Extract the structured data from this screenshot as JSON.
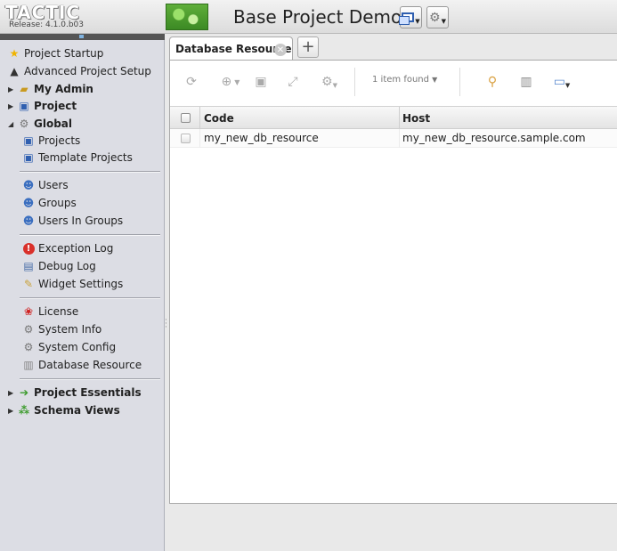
{
  "header": {
    "logo": "TACTIC",
    "release": "Release: 4.1.0.b03",
    "project_title": "Base Project Demo"
  },
  "sidebar": {
    "items": [
      {
        "label": "Project Startup",
        "icon": "star-icon"
      },
      {
        "label": "Advanced Project Setup",
        "icon": "graduation-cap-icon"
      },
      {
        "label": "My Admin",
        "icon": "folder-icon",
        "expanded": false
      },
      {
        "label": "Project",
        "icon": "window-icon",
        "expanded": false
      },
      {
        "label": "Global",
        "icon": "gear-icon",
        "expanded": true
      },
      {
        "label": "Projects",
        "icon": "window-icon"
      },
      {
        "label": "Template Projects",
        "icon": "window-icon"
      },
      {
        "label": "Users",
        "icon": "user-icon"
      },
      {
        "label": "Groups",
        "icon": "group-icon"
      },
      {
        "label": "Users In Groups",
        "icon": "users-in-groups-icon"
      },
      {
        "label": "Exception Log",
        "icon": "alert-icon"
      },
      {
        "label": "Debug Log",
        "icon": "log-icon"
      },
      {
        "label": "Widget Settings",
        "icon": "wrench-icon"
      },
      {
        "label": "License",
        "icon": "ribbon-icon"
      },
      {
        "label": "System Info",
        "icon": "gear-page-icon"
      },
      {
        "label": "System Config",
        "icon": "gear-page-icon"
      },
      {
        "label": "Database Resource",
        "icon": "database-icon"
      },
      {
        "label": "Project Essentials",
        "icon": "arrow-page-icon",
        "expanded": false
      },
      {
        "label": "Schema Views",
        "icon": "schema-icon",
        "expanded": false
      }
    ]
  },
  "main": {
    "tab_label": "Database Resource",
    "toolbar": {
      "items_found": "1 item found"
    },
    "table": {
      "columns": [
        "Code",
        "Host"
      ],
      "rows": [
        [
          "my_new_db_resource",
          "my_new_db_resource.sample.com"
        ]
      ]
    }
  },
  "colors": {
    "sidebar_bg": "#dcdde4",
    "header_bg": "#e6e6e6",
    "logo_green": "#4b9c2e"
  }
}
